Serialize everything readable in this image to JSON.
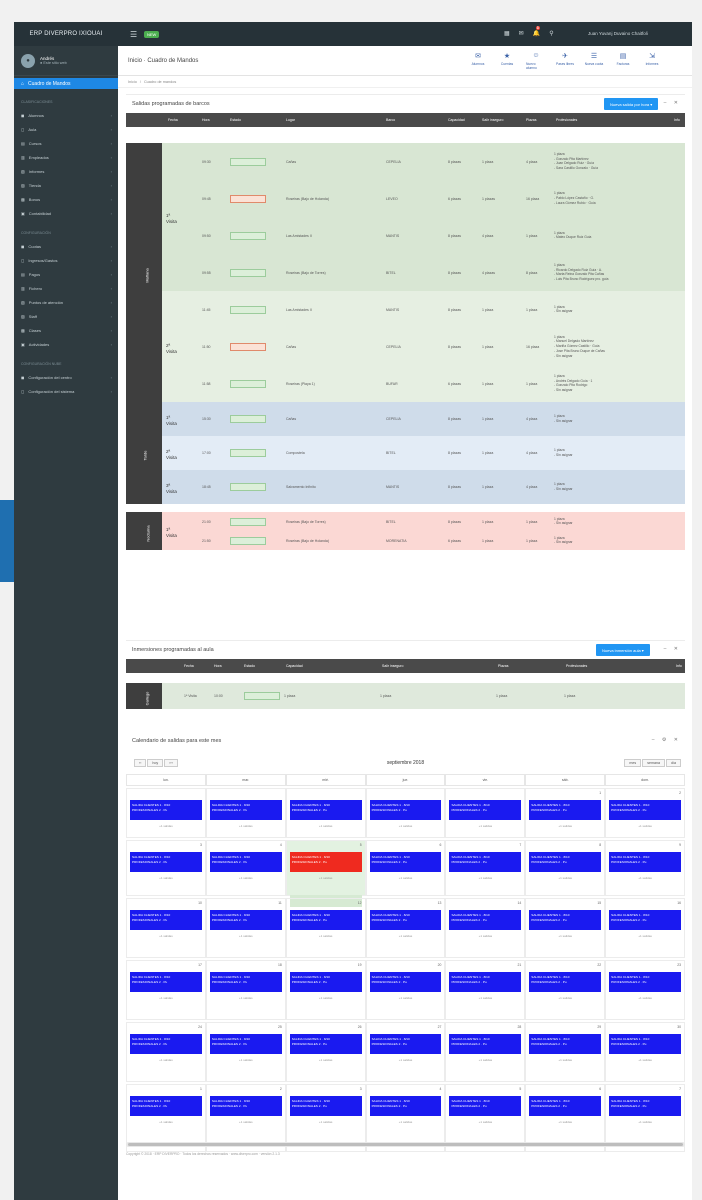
{
  "brand": "ERP DIVERPRO IXIOUAI",
  "topbar": {
    "new_badge": "NEW",
    "user": "Juan Yuvanj Duvaino Chaitfoli"
  },
  "sidebar": {
    "user_name": "Andrés",
    "user_status": "● Este sitio web",
    "active_item": "Cuadro de Mandos",
    "sections": [
      {
        "title": "CLASIFICACIONES",
        "items": [
          "Alumnos",
          "Aula",
          "Cursos",
          "Empleados",
          "Informes",
          "Tienda",
          "Bonos",
          "Contabilidad"
        ]
      },
      {
        "title": "CONFIGURACIÓN",
        "items": [
          "Cuotas",
          "Ingresos/Gastos",
          "Pagos",
          "Fichero",
          "Puntos de atención",
          "Staff",
          "Clases",
          "Actividades"
        ]
      },
      {
        "title": "CONFIGURACIÓN NUBE",
        "items": [
          "Configuración del centro",
          "Configuración del sistema"
        ]
      }
    ]
  },
  "page": {
    "title": "Inicio · Cuadro de Mandos",
    "breadcrumb": [
      "Inicio",
      "/",
      "Cuadro de mandos"
    ],
    "actions": [
      "Alumnos",
      "Cuentas",
      "Nuevo alumno",
      "Pases libres",
      "Nueva cuota",
      "Facturas",
      "Informes"
    ]
  },
  "salidas": {
    "title": "Salidas programadas de barcos",
    "button": "Nueva salida por hora ▾",
    "headers": [
      "Fecha",
      "Hora",
      "Estado",
      "Lugar",
      "Barco",
      "Capacidad",
      "Salir inseguro",
      "Plazas",
      "Profesionales",
      "Info"
    ],
    "groups": [
      {
        "label": "Mañana",
        "turns": [
          {
            "turn": "1ª Visita",
            "rows": [
              {
                "hora": "09:30",
                "estado": "green",
                "lugar": "Cañas",
                "barco": "CEPELIA",
                "cap": "8 plazas",
                "ins": "1 plaza",
                "plazas": "4 plaza",
                "obs": [
                  "1 plaza",
                  "- Gonzalo Pita Martínez",
                  "- Juan Delgado Ruiz · Guía",
                  "- Sara Castillo Gonzalo · Guía"
                ]
              },
              {
                "hora": "09:45",
                "estado": "red",
                "lugar": "Roseiras (Bajo de Holanda)",
                "barco": "LEVEO",
                "cap": "6 plazas",
                "ins": "1 plazas",
                "plazas": "16 plaza",
                "obs": [
                  "1 plaza",
                  "- Pablo López Castaño · G.",
                  "- Laura Gómez Rubio · Guía"
                ]
              },
              {
                "hora": "09:50",
                "estado": "green",
                "lugar": "Las Amistades II",
                "barco": "MANTIS",
                "cap": "8 plazas",
                "ins": "4 plaza",
                "plazas": "1 plaza",
                "obs": [
                  "1 plaza",
                  "- Mateo Duque Ruiz Guía"
                ]
              },
              {
                "hora": "09:55",
                "estado": "green",
                "lugar": "Roseiras (Bajo de Torres)",
                "barco": "BITEL",
                "cap": "8 plazas",
                "ins": "4 plazas",
                "plazas": "8 plaza",
                "obs": [
                  "1 plaza",
                  "- Ricardo Delgado Ruiz Guía · A.",
                  "- Marta Reina Gonzalo Pita Cañas",
                  "- Luis Pita Bruno Rodríguez pro. guía"
                ]
              }
            ]
          },
          {
            "turn": "2ª Visita",
            "rows": [
              {
                "hora": "11:45",
                "estado": "green",
                "lugar": "Las Amistades II",
                "barco": "MANTIS",
                "cap": "8 plazas",
                "ins": "1 plaza",
                "plazas": "1 plaza",
                "obs": [
                  "1 plaza",
                  "- Sin asignar"
                ]
              },
              {
                "hora": "11:50",
                "estado": "red",
                "lugar": "Cañas",
                "barco": "CEPELIA",
                "cap": "8 plazas",
                "ins": "1 plaza",
                "plazas": "16 plaza",
                "obs": [
                  "1 plaza",
                  "- Manuel Delgado Martínez",
                  "- Mariña Gómez Castillo · Guía",
                  "- Jose Pita Bruno Duque de Cañas",
                  "- Sin asignar"
                ]
              },
              {
                "hora": "11:58",
                "estado": "green",
                "lugar": "Roseiras (Playa 1)",
                "barco": "BUFAR",
                "cap": "6 plazas",
                "ins": "1 plaza",
                "plazas": "1 plaza",
                "obs": [
                  "1 plaza",
                  "- Andrés Delgado Guía · 1",
                  "- Gonzalo Pita Rodrigo",
                  "- Sin asignar"
                ]
              }
            ]
          }
        ]
      },
      {
        "label": "Tarde",
        "turns": [
          {
            "turn": "1ª Visita",
            "rows": [
              {
                "hora": "15:30",
                "estado": "green",
                "lugar": "Cañas",
                "barco": "CEPELIA",
                "cap": "8 plazas",
                "ins": "1 plaza",
                "plazas": "4 plaza",
                "obs": [
                  "1 plaza",
                  "- Sin asignar"
                ]
              }
            ]
          },
          {
            "turn": "2ª Visita",
            "rows": [
              {
                "hora": "17:00",
                "estado": "green",
                "lugar": "Compostela",
                "barco": "BITEL",
                "cap": "8 plazas",
                "ins": "1 plaza",
                "plazas": "4 plaza",
                "obs": [
                  "1 plaza",
                  "- Sin asignar"
                ]
              }
            ]
          },
          {
            "turn": "3ª Visita",
            "rows": [
              {
                "hora": "18:45",
                "estado": "green",
                "lugar": "Salvamento Infinito",
                "barco": "MANTIS",
                "cap": "8 plazas",
                "ins": "1 plaza",
                "plazas": "4 plaza",
                "obs": [
                  "1 plaza",
                  "- Sin asignar"
                ]
              }
            ]
          }
        ]
      },
      {
        "label": "Nocturna",
        "turns": [
          {
            "turn": "1ª Visita",
            "rows": [
              {
                "hora": "21:00",
                "estado": "green",
                "lugar": "Roseiras (Bajo de Torres)",
                "barco": "BITEL",
                "cap": "8 plazas",
                "ins": "1 plaza",
                "plazas": "1 plaza",
                "obs": [
                  "1 plaza",
                  "- Sin asignar"
                ]
              },
              {
                "hora": "21:50",
                "estado": "green",
                "lugar": "Roseiras (Bajo de Holanda)",
                "barco": "MORENATIA",
                "cap": "6 plazas",
                "ins": "1 plaza",
                "plazas": "1 plaza",
                "obs": [
                  "1 plaza",
                  "- Sin asignar"
                ]
              }
            ]
          }
        ]
      }
    ]
  },
  "inmersiones": {
    "title": "Inmersiones programadas al aula",
    "button": "Nueva inmersión aula ▾",
    "headers": [
      "Fecha",
      "Hora",
      "Estado",
      "Capacidad",
      "Salir inseguro",
      "Plazas",
      "Profesionales",
      "Info"
    ],
    "group": "Gallego",
    "row": {
      "turn": "1ª Visita",
      "hora": "10:00",
      "cap": "1 plaza",
      "ins": "1 plaza",
      "plazas": "1 plaza",
      "obs": "1 plaza"
    }
  },
  "calendar": {
    "title": "Calendario de salidas para este mes",
    "nav": [
      "‹‹",
      "hoy",
      "›››"
    ],
    "month": "septiembre 2018",
    "views": [
      "mes",
      "semana",
      "día"
    ],
    "days": [
      "lun.",
      "mar.",
      "mié.",
      "jue.",
      "vie.",
      "sáb.",
      "dom."
    ],
    "weeks": [
      [
        "",
        "",
        "",
        "",
        "",
        "1",
        "2"
      ],
      [
        "3",
        "4",
        "5",
        "6",
        "7",
        "8",
        "9"
      ],
      [
        "10",
        "11",
        "12",
        "13",
        "14",
        "15",
        "16"
      ],
      [
        "17",
        "18",
        "19",
        "20",
        "21",
        "22",
        "23"
      ],
      [
        "24",
        "25",
        "26",
        "27",
        "28",
        "29",
        "30"
      ],
      [
        "1",
        "2",
        "3",
        "4",
        "5",
        "6",
        "7"
      ]
    ],
    "event_line1": "SALIDA CLIENTES 1 · 8/10",
    "event_line2": "PROFESIONALES 2 · Pu",
    "event_red_line1": "SALIDA CLIENTES 1 · 8/10",
    "event_red_line2": "PROFESIONALES 2 · Pu",
    "more": "+1 salidas"
  },
  "footer": "Copyright © 2018 · ERP DIVERPRO · Todos los derechos reservados · www.diverpro.com · versión 2.1.3"
}
